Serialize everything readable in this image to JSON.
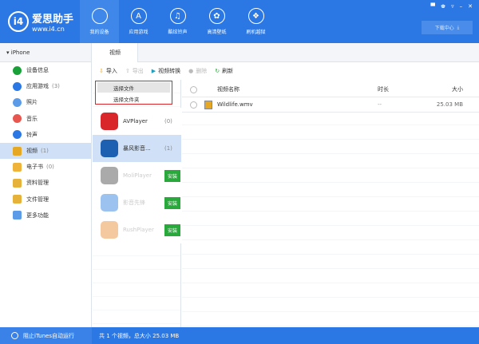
{
  "app": {
    "logo_name": "爱思助手",
    "logo_url": "www.i4.cn",
    "download_center": "下载中心"
  },
  "nav": [
    {
      "label": "我的设备",
      "icon": "apple-icon"
    },
    {
      "label": "应用游戏",
      "icon": "app-store-icon"
    },
    {
      "label": "酷炫铃声",
      "icon": "music-icon"
    },
    {
      "label": "高清壁纸",
      "icon": "flower-icon"
    },
    {
      "label": "刷机越狱",
      "icon": "dropbox-icon"
    }
  ],
  "sidebar": {
    "device": "iPhone",
    "items": [
      {
        "label": "设备信息",
        "count": "",
        "color": "#1aa038"
      },
      {
        "label": "应用游戏",
        "count": "(3)",
        "color": "#2b78e4"
      },
      {
        "label": "照片",
        "count": "",
        "color": "#5b9be8"
      },
      {
        "label": "音乐",
        "count": "",
        "color": "#e8574f"
      },
      {
        "label": "铃声",
        "count": "",
        "color": "#2b78e4"
      },
      {
        "label": "视频",
        "count": "(1)",
        "color": "#e6a822"
      },
      {
        "label": "电子书",
        "count": "(0)",
        "color": "#f0b33a"
      },
      {
        "label": "资料管理",
        "count": "",
        "color": "#e6b23a"
      },
      {
        "label": "文件管理",
        "count": "",
        "color": "#e6b23a"
      },
      {
        "label": "更多功能",
        "count": "",
        "color": "#5b9be8"
      }
    ]
  },
  "tab": "视频",
  "toolbar": {
    "import": "导入",
    "export": "导出",
    "convert": "视频转换",
    "delete": "删除",
    "refresh": "刷新"
  },
  "dropdown": [
    "选择文件",
    "选择文件夹"
  ],
  "players": [
    {
      "name": "AVPlayer",
      "count": "(0)",
      "color": "#d9262b"
    },
    {
      "name": "暴风影音...",
      "count": "(1)",
      "color": "#1d5fb0"
    },
    {
      "name": "MoliPlayer",
      "install": "安装",
      "color": "#aaa"
    },
    {
      "name": "影音先锋",
      "install": "安装",
      "color": "#9cc2ef"
    },
    {
      "name": "RushPlayer",
      "install": "安装",
      "color": "#f5c9a0"
    }
  ],
  "table": {
    "headers": [
      "视频名称",
      "时长",
      "大小"
    ],
    "rows": [
      {
        "name": "Wildlife.wmv",
        "duration": "--",
        "size": "25.03 MB"
      }
    ]
  },
  "status": {
    "itunes": "阻止iTunes自动运行",
    "summary": "共 1 个视频，总大小 25.03 MB"
  }
}
